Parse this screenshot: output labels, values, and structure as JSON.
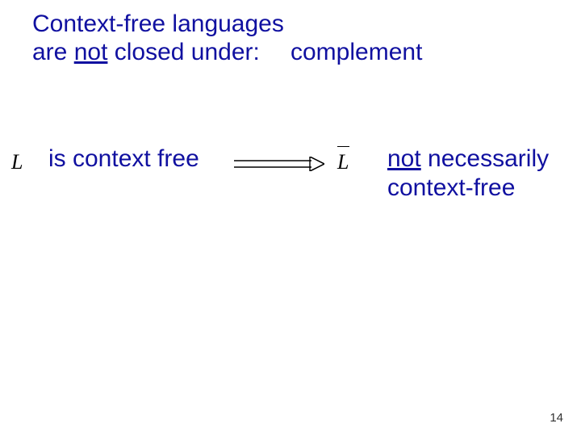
{
  "title_line1": "Context-free languages",
  "title_line2_a": "are ",
  "title_line2_not": "not",
  "title_line2_b": " closed under:",
  "complement": "complement",
  "L_symbol": "L",
  "is_cf": "is context free",
  "Lbar_symbol": "L",
  "not_word": "not",
  "necessarily": " necessarily",
  "context_free": "context-free",
  "page_number": "14"
}
